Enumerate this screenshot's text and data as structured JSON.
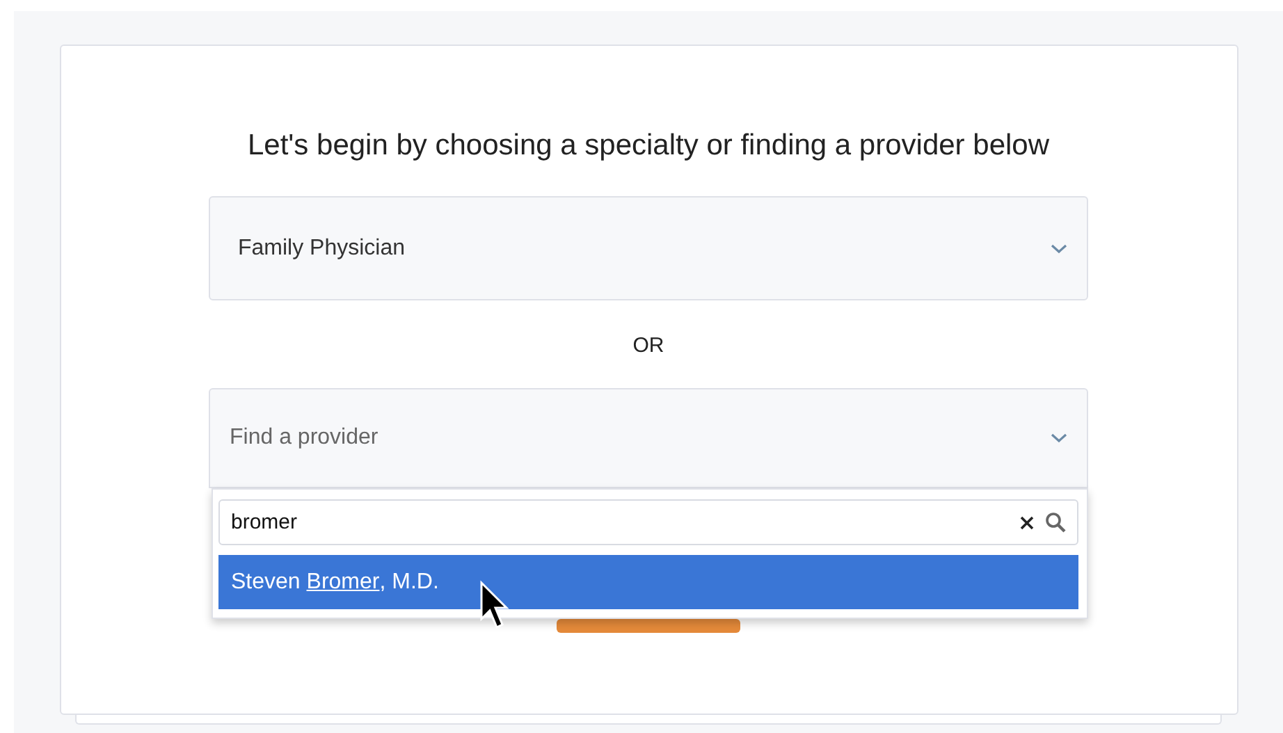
{
  "heading": "Let's begin by choosing a specialty or finding a provider below",
  "specialty_select": {
    "value": "Family Physician"
  },
  "separator": "OR",
  "provider_select": {
    "placeholder": "Find a provider",
    "expanded": true
  },
  "provider_search": {
    "value": "bromer"
  },
  "results": [
    {
      "before": "Steven ",
      "match": "Bromer",
      "after": ", M.D.",
      "selected": true
    }
  ]
}
